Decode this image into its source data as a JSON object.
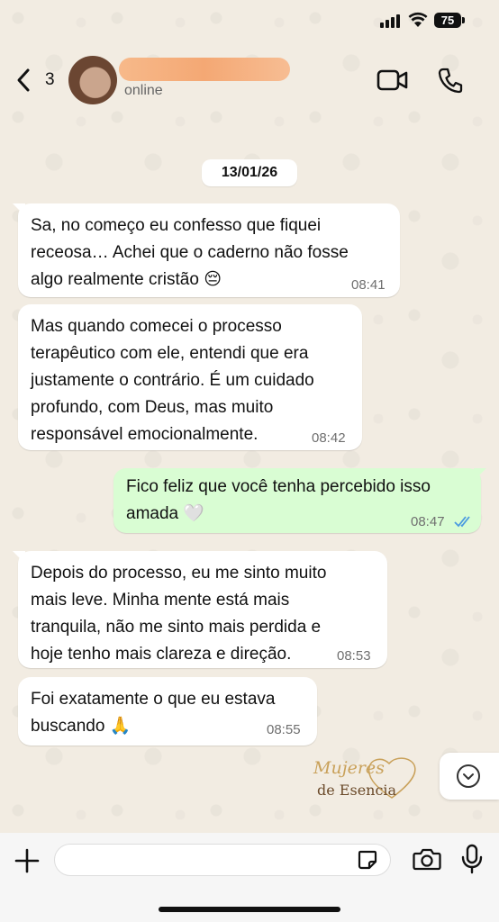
{
  "status_bar": {
    "battery": "75"
  },
  "header": {
    "back_count": "3",
    "contact_name": "",
    "contact_status": "online"
  },
  "chat": {
    "date": "13/01/26",
    "messages": [
      {
        "direction": "in",
        "text": "Sa, no começo eu confesso que fiquei\nreceosa… Achei que o caderno não fosse\nalgo realmente cristão 😔",
        "time": "08:41"
      },
      {
        "direction": "in",
        "text": "Mas quando comecei o processo\nterapêutico com ele, entendi que era\njustamente o contrário. É um cuidado\nprofundo, com Deus, mas muito\nresponsável emocionalmente.",
        "time": "08:42"
      },
      {
        "direction": "out",
        "text": "Fico feliz que você tenha percebido isso\namada 🤍",
        "time": "08:47",
        "status": "read"
      },
      {
        "direction": "in",
        "text": "Depois do processo, eu me sinto muito\nmais leve. Minha mente está mais\ntranquila, não me sinto mais perdida e\nhoje tenho mais clareza e direção.",
        "time": "08:53"
      },
      {
        "direction": "in",
        "text": "Foi exatamente o que eu estava\nbuscando 🙏",
        "time": "08:55"
      }
    ]
  },
  "watermark": {
    "line1": "Mujeres",
    "line2": "de Esencia"
  },
  "input": {
    "value": "",
    "placeholder": ""
  },
  "colors": {
    "incoming": "#ffffff",
    "outgoing": "#d9fdd3",
    "read_tick": "#4a9ae0",
    "watermark_gold": "#c9a15a"
  }
}
